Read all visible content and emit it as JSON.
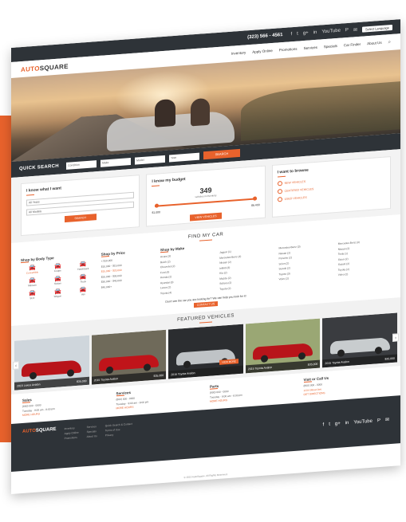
{
  "topbar": {
    "phone": "(323) 566 - 4561",
    "social": [
      "f",
      "t",
      "g+",
      "in",
      "YouTube",
      "P",
      "✉"
    ],
    "language": "Select Language"
  },
  "header": {
    "logo_prefix": "AUTO",
    "logo_suffix": "SQUARE",
    "nav": [
      "Inventory",
      "Apply Online",
      "Promotions",
      "Services",
      "Specials",
      "Car Finder",
      "About Us"
    ]
  },
  "quick_search": {
    "title": "QUICK SEARCH",
    "fields": [
      "Condition",
      "Make",
      "Model",
      "Year"
    ],
    "button": "SEARCH"
  },
  "cards": {
    "want": {
      "title": "I know what I want",
      "select1": "All Years",
      "select2": "All Models",
      "button": "SEARCH"
    },
    "budget": {
      "title": "I know my budget",
      "count": "349",
      "count_sub": "vehicles in inventory",
      "min": "$1,000",
      "max": "$6,400",
      "button": "VIEW VEHICLES"
    },
    "browse": {
      "title": "I want to browse",
      "items": [
        "NEW VEHICLES",
        "CERTIFIED VEHICLES",
        "USED VEHICLES"
      ]
    }
  },
  "find_my_car": {
    "title": "FIND MY CAR",
    "body_type": {
      "title": "Shop by Body Type",
      "items": [
        "Convertible",
        "Coupe",
        "Hatchback",
        "Minivan",
        "Sedan",
        "Truck",
        "SUV",
        "Wagon",
        "Van"
      ]
    },
    "price": {
      "title": "Shop by Price",
      "items": [
        "< $10,000",
        "$10,000 - $15,000",
        "$15,000 - $20,000",
        "$20,000 - $30,000",
        "$30,000 - $40,000",
        "$40,000+"
      ]
    },
    "make": {
      "title": "Shop by Make",
      "col1": [
        "Acura (3)",
        "Buick (2)",
        "Chevrolet (2)",
        "Ford (4)",
        "Honda (2)",
        "Hyundai (3)",
        "Lexus (2)",
        "Toyota (4)"
      ],
      "col2": [
        "Jaguar (1)",
        "Mercedes-Benz (4)",
        "Nissan (2)",
        "Infiniti (3)",
        "Kia (2)",
        "Mazda (2)",
        "Subaru (2)",
        "Toyota (2)"
      ],
      "col3": [
        "Mercedes-Benz (3)",
        "Nissan (2)",
        "Porsche (2)",
        "Scion (2)",
        "Suzuki (2)",
        "Toyota (3)",
        "Volvo (2)"
      ],
      "col4": [
        "Mercedes-Benz (3)",
        "Nissan (2)",
        "Tesla (1)",
        "Scion (2)",
        "Suzuki (2)",
        "Toyota (2)",
        "Volvo (2)"
      ]
    },
    "notice": "Don't see the car you are looking for? We can help you look for it!",
    "contact_button": "CONTACT US"
  },
  "featured": {
    "title": "FEATURED VEHICLES",
    "cars": [
      {
        "name": "2015 Lexus Avalon",
        "price": "$35,000",
        "color": "#b8141a",
        "bg": "#cfd6dc",
        "more": ""
      },
      {
        "name": "2015 Toyota Avalon",
        "price": "$35,000",
        "color": "#c0141a",
        "bg": "#6f6a5a",
        "more": ""
      },
      {
        "name": "2015 Toyota Avalon",
        "price": "",
        "color": "#bfc3c6",
        "bg": "#2b2d30",
        "more": "VIEW MORE"
      },
      {
        "name": "2015 Toyota Avalon",
        "price": "$35,000",
        "color": "#b8141a",
        "bg": "#9aa774",
        "more": ""
      },
      {
        "name": "2015 Toyota Avalon",
        "price": "$35,000",
        "color": "#c8ccce",
        "bg": "#3a3c40",
        "more": ""
      }
    ]
  },
  "info": [
    {
      "title": "Sales",
      "phone": "(800) 000 - 0000",
      "hours": "Tuesday · 9:00 am - 8:00 pm",
      "link": "MORE HOURS"
    },
    {
      "title": "Services",
      "phone": "(800) 000 - 0000",
      "hours": "Tuesday · 9:00 am - 8:00 pm",
      "link": "MORE HOURS"
    },
    {
      "title": "Parts",
      "phone": "(800) 000 - 0000",
      "hours": "Tuesday · 9:00 am - 8:00 pm",
      "link": "MORE HOURS"
    },
    {
      "title": "Visit or Call Us",
      "phone": "(800) 000 - 0000",
      "hours": "1234 Street Ave",
      "link": "GET DIRECTIONS"
    }
  ],
  "footer": {
    "logo_prefix": "AUTO",
    "logo_suffix": "SQUARE",
    "col1": [
      "Inventory",
      "Apply Online",
      "Promotions"
    ],
    "col2": [
      "Services",
      "Specials",
      "About Us"
    ],
    "col3": [
      "Quick Search & Contact",
      "Terms of Use",
      "Privacy"
    ],
    "social": [
      "f",
      "t",
      "g+",
      "in",
      "YouTube",
      "P",
      "✉"
    ],
    "copyright": "© 2015 AutoSquare. All Rights Reserved."
  },
  "colors": {
    "accent": "#e8622c",
    "dark": "#2e3338"
  }
}
